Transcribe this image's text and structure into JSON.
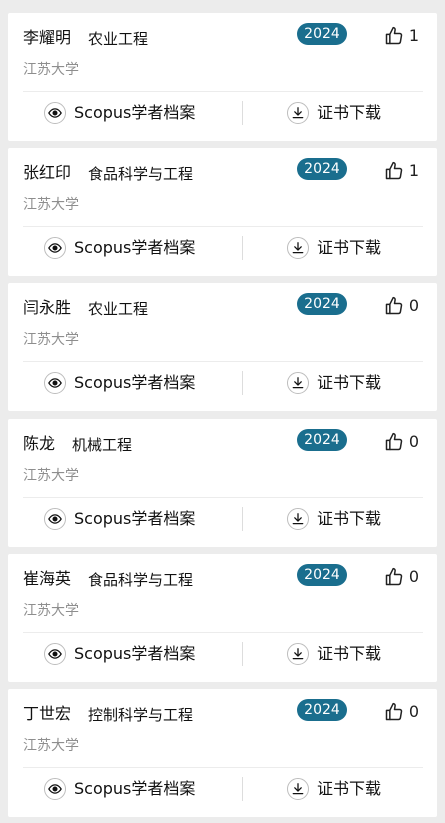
{
  "colors": {
    "page_background": "#ececec",
    "card_background": "#ffffff",
    "badge_background": "#1a6e8e",
    "badge_text": "#ffffff",
    "muted_text": "#8e8e8e"
  },
  "icons": {
    "like": "thumbs-up-icon",
    "scopus": "eye-icon",
    "download": "download-icon"
  },
  "actions": {
    "scopus_label": "Scopus学者档案",
    "certificate_label": "证书下载"
  },
  "records": [
    {
      "name": "李耀明",
      "major": "农业工程",
      "year": "2024",
      "likes": "1",
      "school": "江苏大学"
    },
    {
      "name": "张红印",
      "major": "食品科学与工程",
      "year": "2024",
      "likes": "1",
      "school": "江苏大学"
    },
    {
      "name": "闫永胜",
      "major": "农业工程",
      "year": "2024",
      "likes": "0",
      "school": "江苏大学"
    },
    {
      "name": "陈龙",
      "major": "机械工程",
      "year": "2024",
      "likes": "0",
      "school": "江苏大学"
    },
    {
      "name": "崔海英",
      "major": "食品科学与工程",
      "year": "2024",
      "likes": "0",
      "school": "江苏大学"
    },
    {
      "name": "丁世宏",
      "major": "控制科学与工程",
      "year": "2024",
      "likes": "0",
      "school": "江苏大学"
    }
  ]
}
